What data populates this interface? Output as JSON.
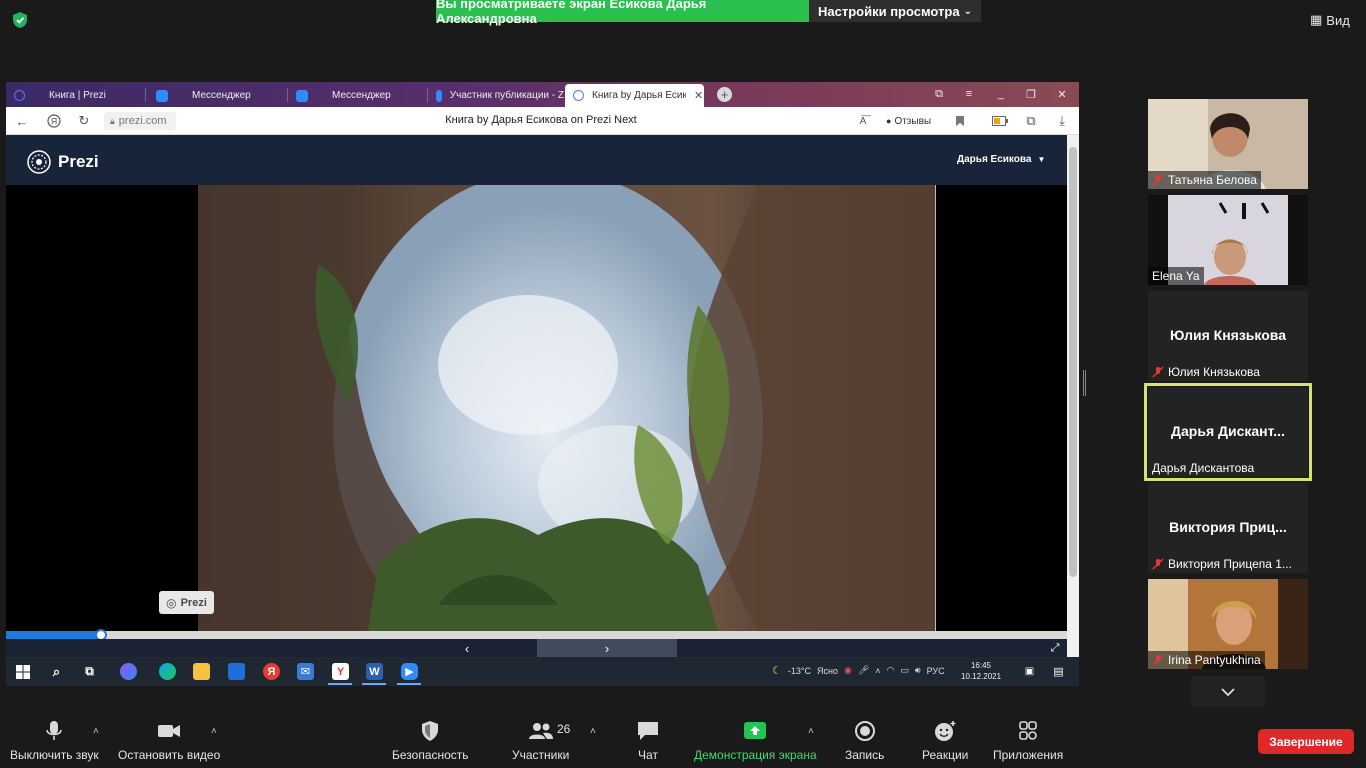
{
  "zoom_top": {
    "share_banner": "Вы просматриваете экран Есикова Дарья Александровна",
    "view_settings": "Настройки просмотра",
    "view_button": "Вид"
  },
  "browser": {
    "tabs": [
      {
        "label": "Книга | Prezi"
      },
      {
        "label": "Мессенджер"
      },
      {
        "label": "Мессенджер"
      },
      {
        "label": "Участник публикации - Z"
      },
      {
        "label": "Книга by Дарья Есиков"
      }
    ],
    "url": "prezi.com",
    "page_title": "Книга by Дарья Есикова on Prezi Next",
    "reviews_label": "Отзывы"
  },
  "prezi": {
    "logo": "Prezi",
    "user": "Дарья Есикова",
    "badge": "Prezi",
    "progress": 0.09
  },
  "taskbar": {
    "yandex_letter": "Я",
    "word_letter": "W",
    "weather": "-13°C",
    "weather_text": "Ясно",
    "lang": "РУС",
    "time": "16:45",
    "date": "10.12.2021"
  },
  "participants": [
    {
      "name": "Татьяна Белова",
      "muted": true,
      "video": true
    },
    {
      "name": "Elena Ya",
      "muted": false,
      "video": true
    },
    {
      "center": "Юлия Князькова",
      "name": "Юлия Князькова",
      "muted": true,
      "video": false
    },
    {
      "center": "Дарья Дискант...",
      "name": "Дарья Дискантова",
      "muted": false,
      "video": false,
      "active": true
    },
    {
      "center": "Виктория Приц...",
      "name": "Виктория Прицепа 1...",
      "muted": true,
      "video": false
    },
    {
      "name": "Irina Pantyukhina",
      "muted": true,
      "video": true
    }
  ],
  "toolbar": {
    "mute": "Выключить звук",
    "video": "Остановить видео",
    "security": "Безопасность",
    "participants": "Участники",
    "participants_count": "26",
    "chat": "Чат",
    "share": "Демонстрация экрана",
    "record": "Запись",
    "reactions": "Реакции",
    "apps": "Приложения",
    "end": "Завершение"
  },
  "colors": {
    "share_green": "#2bbf4f",
    "end_red": "#e02828",
    "active_speaker": "#d7e36a",
    "prezi_blue": "#1f7ae0"
  }
}
